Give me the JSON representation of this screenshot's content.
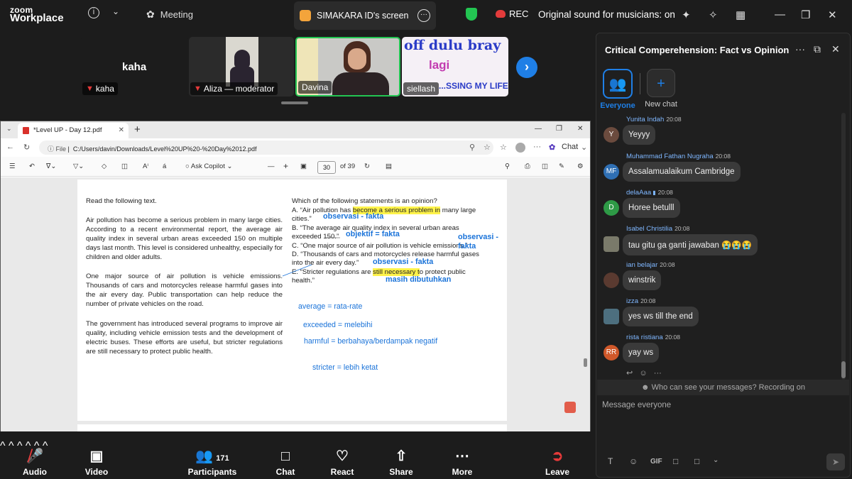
{
  "topbar": {
    "logo_top": "zoom",
    "logo_bottom": "Workplace",
    "meeting_label": "Meeting",
    "share_label": "SIMAKARA ID's screen",
    "rec_label": "REC",
    "sound_label": "Original sound for musicians: on"
  },
  "videos": {
    "tiles": [
      {
        "name": "kaha",
        "big_name": "kaha"
      },
      {
        "name": "Aliza — moderator"
      },
      {
        "name": "Davina"
      },
      {
        "name": "siellash",
        "banner_line1": "off dulu bray",
        "banner_line2": "lagi",
        "banner_line3": "...SSING MY LIFE"
      }
    ]
  },
  "browser": {
    "tab_title": "*Level UP - Day 12.pdf",
    "url_prefix": "File",
    "url": "C:/Users/davin/Downloads/Level%20UP%20-%20Day%2012.pdf",
    "chat_btn": "Chat",
    "ask_copilot": "Ask Copilot",
    "page_current": "30",
    "page_total": "of 39"
  },
  "pdf": {
    "left_heading": "Read the following text.",
    "para1": "Air pollution has become a serious problem in many large cities. According to a recent environmental report, the average air quality index in several urban areas exceeded 150 on multiple days last month. This level is considered unhealthy, especially for children and older adults.",
    "para2": "One major source of air pollution is vehicle emissions. Thousands of cars and motorcycles release harmful gases into the air every day. Public transportation can help reduce the number of private vehicles on the road.",
    "para3": "The government has introduced several programs to improve air quality, including vehicle emission tests and the development of electric buses. These efforts are useful, but stricter regulations are still necessary to protect public health.",
    "question": "Which of the following statements is an opinion?",
    "optA_pre": "A. “Air pollution has ",
    "optA_hl": "become a serious problem in",
    "optA_post": " many large",
    "optA_line2": "cities.”",
    "optB_line1": "B. “The average air quality index in several urban areas",
    "optB_line2": "exceeded 150.”",
    "optC": "C. “One major source of air pollution is vehicle emissions.”",
    "optD_line1": "D. “Thousands of cars and motorcycles release harmful gases",
    "optD_line2": "into the air every day.”",
    "optE_pre": "E. “Stricter regulations are ",
    "optE_hl": "still necessary t",
    "optE_post": "o protect public",
    "optE_line2": "health.”",
    "note_a": "observasi - fakta",
    "note_b": "objektif = fakta",
    "note_c_1": "observasi -",
    "note_c_2": "fakta",
    "note_d": "observasi - fakta",
    "note_e": "masih dibutuhkan",
    "vocab1": "average = rata-rate",
    "vocab2": "exceeded = melebihi",
    "vocab3": "harmful = berbahaya/berdampak negatif",
    "vocab4": "stricter = lebih ketat"
  },
  "bottombar": {
    "audio": "Audio",
    "video": "Video",
    "participants": "Participants",
    "participants_count": "171",
    "chat": "Chat",
    "react": "React",
    "share": "Share",
    "more": "More",
    "leave": "Leave"
  },
  "chat": {
    "title": "Critical Comperehension: Fact vs Opinion, ...",
    "tab_everyone": "Everyone",
    "tab_new": "New chat",
    "messages": [
      {
        "initials": "Y",
        "color": "#6b4b3e",
        "name": "Yunita Indah",
        "time": "20:08",
        "text": "Yeyyy"
      },
      {
        "initials": "MF",
        "color": "#2f6fb3",
        "name": "Muhammad Fathan Nugraha",
        "time": "20:08",
        "text": "Assalamualaikum Cambridge"
      },
      {
        "initials": "D",
        "color": "#2e9a46",
        "name": "delaAaa",
        "time": "20:08",
        "text": "Horee betulll"
      },
      {
        "initials": "",
        "color": "#7a7a6a",
        "name": "Isabel Christilia",
        "time": "20:08",
        "text": "tau gitu ga ganti jawaban 😭😭😭"
      },
      {
        "initials": "",
        "color": "#5a3a30",
        "name": "ian belajar",
        "time": "20:08",
        "text": "winstrik"
      },
      {
        "initials": "",
        "color": "#4d6f7f",
        "name": "izza",
        "time": "20:08",
        "text": "yes ws till the end"
      },
      {
        "initials": "RR",
        "color": "#d0582a",
        "name": "rista ristiana",
        "time": "20:08",
        "text": "yay ws"
      }
    ],
    "notice": "Who can see your messages? Recording on",
    "input_placeholder": "Message everyone",
    "gif": "GIF"
  }
}
